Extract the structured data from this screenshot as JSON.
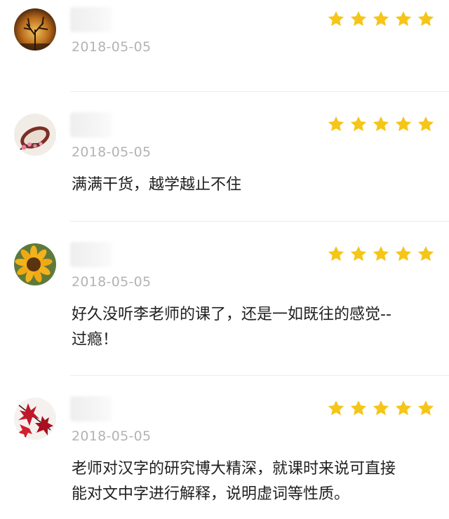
{
  "reviews": [
    {
      "avatar_icon": "autumn-tree-avatar-icon",
      "date": "2018-05-05",
      "rating": 5,
      "comment": ""
    },
    {
      "avatar_icon": "plum-blossom-avatar-icon",
      "date": "2018-05-05",
      "rating": 5,
      "comment": "满满干货，越学越止不住"
    },
    {
      "avatar_icon": "sunflower-avatar-icon",
      "date": "2018-05-05",
      "rating": 5,
      "comment": "好久没听李老师的课了，还是一如既往的感觉--\n过瘾！"
    },
    {
      "avatar_icon": "red-maple-avatar-icon",
      "date": "2018-05-05",
      "rating": 5,
      "comment": "老师对汉字的研究博大精深，就课时来说可直接\n能对文中字进行解释，说明虚词等性质。"
    }
  ],
  "colors": {
    "star": "#f5c518",
    "date": "#b3b3b3",
    "divider": "#ececec"
  }
}
